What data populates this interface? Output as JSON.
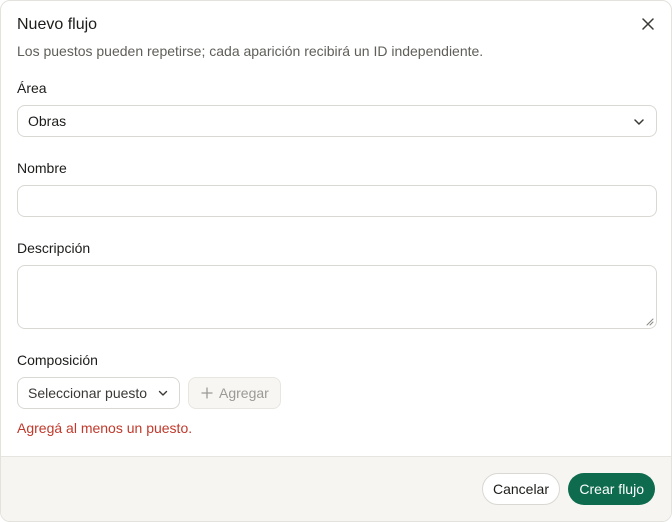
{
  "dialog": {
    "title": "Nuevo flujo",
    "subtitle": "Los puestos pueden repetirse; cada aparición recibirá un ID independiente.",
    "close_icon": "close-icon"
  },
  "form": {
    "area": {
      "label": "Área",
      "value": "Obras"
    },
    "name": {
      "label": "Nombre",
      "value": "",
      "placeholder": ""
    },
    "description": {
      "label": "Descripción",
      "value": "",
      "placeholder": ""
    },
    "composition": {
      "label": "Composición",
      "select_value": "Seleccionar puesto",
      "add_label": "Agregar",
      "error": "Agregá al menos un puesto."
    }
  },
  "footer": {
    "cancel_label": "Cancelar",
    "create_label": "Crear flujo"
  },
  "colors": {
    "primary": "#0f6b4e",
    "error": "#c0392b",
    "footer_bg": "#f6f5f2"
  }
}
